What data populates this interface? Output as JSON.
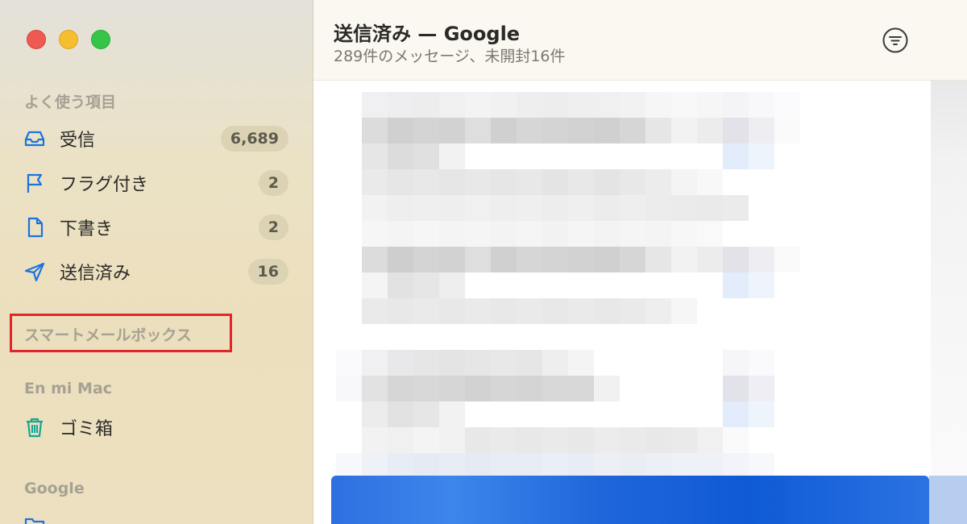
{
  "sidebar": {
    "favorites_title": "よく使う項目",
    "items": [
      {
        "label": "受信",
        "count": "6,689",
        "icon": "inbox-icon"
      },
      {
        "label": "フラグ付き",
        "count": "2",
        "icon": "flag-icon"
      },
      {
        "label": "下書き",
        "count": "2",
        "icon": "document-icon"
      },
      {
        "label": "送信済み",
        "count": "16",
        "icon": "paper-plane-icon"
      }
    ],
    "smart_mailboxes_title": "スマートメールボックス",
    "on_my_mac_title": "En mi Mac",
    "trash_label": "ゴミ箱",
    "google_title": "Google"
  },
  "header": {
    "title": "送信済み — Google",
    "subtitle": "289件のメッセージ、未開封16件"
  },
  "colors": {
    "accent_blue": "#1a73e8",
    "highlight_red": "#e0262a",
    "badge_bg": "#dcd3b4"
  }
}
